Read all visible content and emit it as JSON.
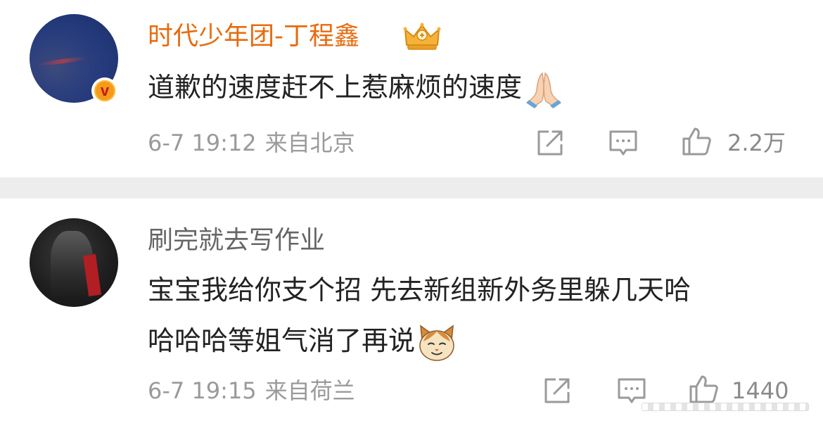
{
  "comments": [
    {
      "username": "时代少年团-丁程鑫",
      "text": "道歉的速度赶不上惹麻烦的速度",
      "time": "6-7 19:12",
      "location": "来自北京",
      "likes": "2.2万",
      "verified": true,
      "username_color": "#e86b0f",
      "emoji": "folded-hands-emoji",
      "badge": "crown-icon"
    },
    {
      "username": "刷完就去写作业",
      "text_line1": "宝宝我给你支个招 先去新组新外务里躲几天哈",
      "text_line2": "哈哈哈等姐气消了再说",
      "time": "6-7 19:15",
      "location": "来自荷兰",
      "likes": "1440",
      "verified": false,
      "username_color": "#666666",
      "emoji": "cat-face-emoji"
    }
  ],
  "colors": {
    "separator": "#ededed",
    "meta_text": "#9a9a9a",
    "body_text": "#222222",
    "icon_stroke": "#9a9a9a"
  }
}
